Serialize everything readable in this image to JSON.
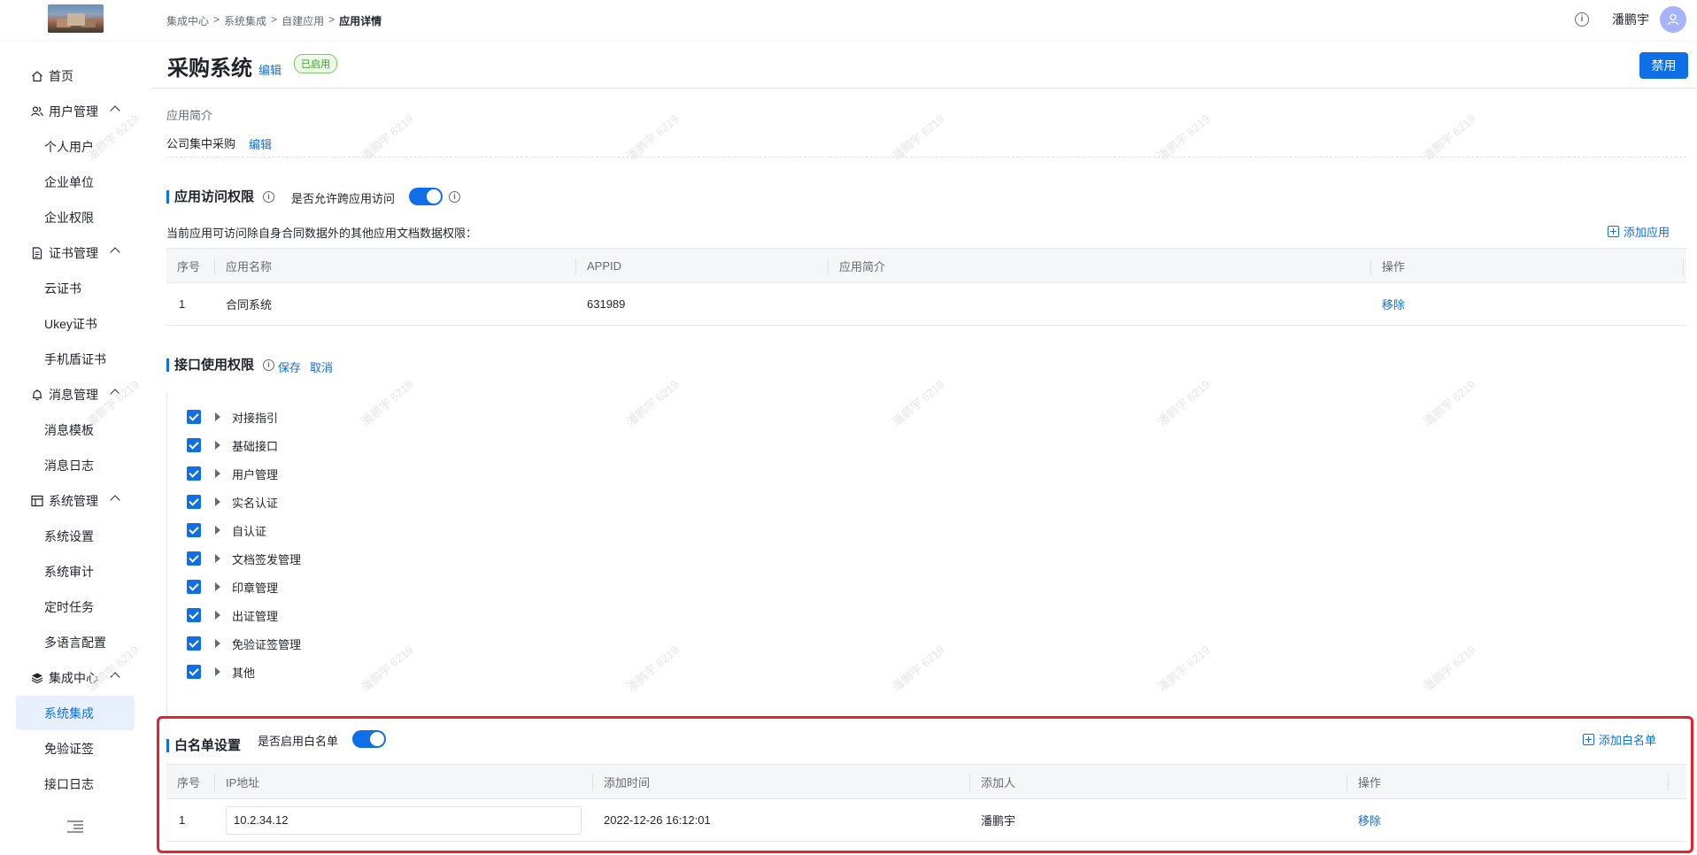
{
  "breadcrumb": [
    "集成中心",
    ">",
    "系统集成",
    ">",
    "自建应用",
    ">",
    "应用详情"
  ],
  "header": {
    "info": "i",
    "username": "潘鹏宇"
  },
  "sidebar": {
    "items": [
      {
        "label": "首页",
        "icon": "home-icon"
      },
      {
        "label": "用户管理",
        "icon": "users-icon"
      },
      {
        "label": "个人用户"
      },
      {
        "label": "企业单位"
      },
      {
        "label": "企业权限"
      },
      {
        "label": "证书管理",
        "icon": "certificate-icon"
      },
      {
        "label": "云证书"
      },
      {
        "label": "Ukey证书"
      },
      {
        "label": "手机盾证书"
      },
      {
        "label": "消息管理",
        "icon": "bell-icon"
      },
      {
        "label": "消息模板"
      },
      {
        "label": "消息日志"
      },
      {
        "label": "系统管理",
        "icon": "layout-icon"
      },
      {
        "label": "系统设置"
      },
      {
        "label": "系统审计"
      },
      {
        "label": "定时任务"
      },
      {
        "label": "多语言配置"
      },
      {
        "label": "集成中心",
        "icon": "layers-icon"
      },
      {
        "label": "系统集成"
      },
      {
        "label": "免验证签"
      },
      {
        "label": "接口日志"
      }
    ]
  },
  "app": {
    "title": "采购系统",
    "edit": "编辑",
    "status": "已启用",
    "disable": "禁用",
    "intro_label": "应用简介",
    "intro_value": "公司集中采购",
    "intro_edit": "编辑"
  },
  "watermark": "潘鹏宇 6219",
  "access": {
    "title": "应用访问权限",
    "toggle_label": "是否允许跨应用访问",
    "desc": "当前应用可访问除自身合同数据外的其他应用文档数据权限：",
    "add": "添加应用",
    "headers": [
      "序号",
      "应用名称",
      "APPID",
      "应用简介",
      "操作"
    ],
    "rows": [
      {
        "no": "1",
        "name": "合同系统",
        "appid": "631989",
        "intro": "",
        "action": "移除"
      }
    ]
  },
  "api": {
    "title": "接口使用权限",
    "save": "保存",
    "cancel": "取消",
    "items": [
      "对接指引",
      "基础接口",
      "用户管理",
      "实名认证",
      "自认证",
      "文档签发管理",
      "印章管理",
      "出证管理",
      "免验证签管理",
      "其他"
    ]
  },
  "whitelist": {
    "title": "白名单设置",
    "toggle_label": "是否启用白名单",
    "add": "添加白名单",
    "headers": [
      "序号",
      "IP地址",
      "添加时间",
      "添加人",
      "操作"
    ],
    "rows": [
      {
        "no": "1",
        "ip": "10.2.34.12",
        "time": "2022-12-26 16:12:01",
        "by": "潘鹏宇",
        "action": "移除"
      }
    ]
  },
  "colors": {
    "accent": "#0e6fe6",
    "highlight": "#e8222a",
    "success": "#36a320"
  }
}
